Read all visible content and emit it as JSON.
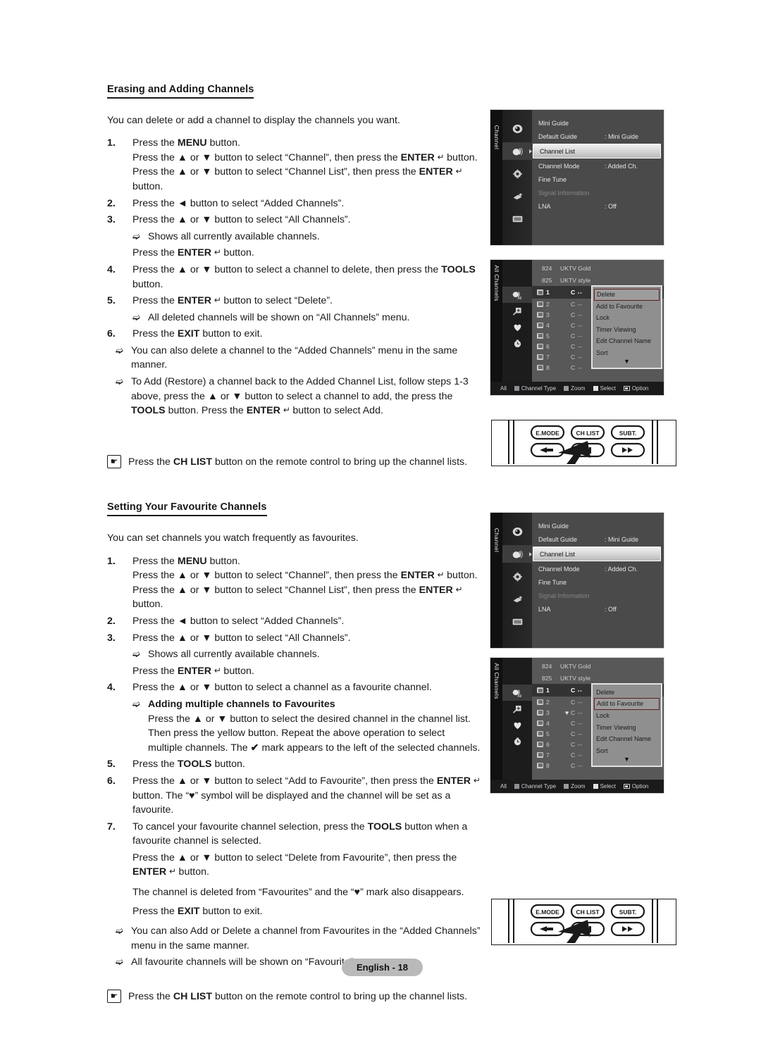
{
  "doc": {
    "footer_label": "English - 18"
  },
  "section1": {
    "heading": "Erasing and Adding Channels",
    "intro": "You can delete or add a channel to display the channels you want.",
    "steps": [
      {
        "num": "1.",
        "lines": [
          "Press the MENU button.",
          "Press the ▲ or ▼ button to select “Channel”, then press the ENTER ↵ button. Press the ▲ or ▼ button to select “Channel List”, then press the ENTER ↵ button."
        ]
      },
      {
        "num": "2.",
        "lines": [
          "Press the ◄ button to select “Added Channels”."
        ]
      },
      {
        "num": "3.",
        "lines": [
          "Press the ▲ or ▼ button to select “All Channels”."
        ]
      },
      {
        "num": "4.",
        "lines": [
          "Press the ▲ or ▼ button to select a channel to delete, then press the TOOLS button."
        ]
      },
      {
        "num": "5.",
        "lines": [
          "Press the ENTER ↵ button to select “Delete”."
        ]
      },
      {
        "num": "6.",
        "lines": [
          "Press the EXIT button to exit."
        ]
      }
    ],
    "sub_after_3a": "Shows all currently available channels.",
    "plain_after_3a": "Press the ENTER ↵ button.",
    "sub_after_5": "All deleted channels will be shown on “All Channels” menu.",
    "notes": [
      "You can also delete a channel to the “Added Channels” menu in the same manner.",
      "To Add (Restore) a channel back to the Added Channel List, follow steps 1-3 above, press the ▲ or ▼ button to select a channel to add, the press the TOOLS button. Press the ENTER ↵ button to select Add."
    ],
    "tip": "Press the CH LIST button on the remote control to bring up the channel lists."
  },
  "section2": {
    "heading": "Setting Your Favourite Channels",
    "intro": "You can set channels you watch frequently as favourites.",
    "steps": [
      {
        "num": "1.",
        "lines": [
          "Press the MENU button.",
          "Press the ▲ or ▼ button to select “Channel”, then press the ENTER ↵ button. Press the ▲ or ▼ button to select “Channel List”, then press the ENTER ↵ button."
        ]
      },
      {
        "num": "2.",
        "lines": [
          "Press the ◄ button to select “Added Channels”."
        ]
      },
      {
        "num": "3.",
        "lines": [
          "Press the ▲ or ▼ button to select “All Channels”."
        ]
      },
      {
        "num": "4.",
        "lines": [
          "Press the ▲ or ▼ button to select a channel as a favourite channel."
        ]
      },
      {
        "num": "5.",
        "lines": [
          "Press the TOOLS button."
        ]
      },
      {
        "num": "6.",
        "lines": [
          "Press the ▲ or ▼ button to select “Add to Favourite”, then press the ENTER ↵ button. The “♥” symbol will be displayed and the channel will be set as a favourite."
        ]
      },
      {
        "num": "7.",
        "lines": [
          "To cancel your favourite channel selection, press the TOOLS button when a favourite channel is selected."
        ]
      }
    ],
    "sub_after_3a": "Shows all currently available channels.",
    "plain_after_3a": "Press the ENTER ↵ button.",
    "sub_multi_title": "Adding multiple channels to Favourites",
    "sub_multi_body": "Press the ▲ or ▼ button to select the desired channel in the channel list. Then press the yellow button. Repeat the above operation to select multiple channels. The ✔ mark appears to the left of the selected channels.",
    "plain_after_7a": "Press the ▲ or ▼ button to select “Delete from Favourite”, then press the ENTER ↵ button.",
    "plain_after_7b": "The channel is deleted from “Favourites” and the “♥” mark also disappears.",
    "plain_after_7c": "Press the EXIT button to exit.",
    "notes": [
      "You can also Add or Delete a channel from Favourites in the “Added Channels” menu in the same manner.",
      "All favourite channels will be shown on “Favourite” menu."
    ],
    "tip": "Press the CH LIST button on the remote control to bring up the channel lists."
  },
  "osd_channel_menu": {
    "tab_label": "Channel",
    "icons": [
      "guide-icon",
      "channel-icon",
      "setup-icon",
      "input-icon",
      "picture-icon"
    ],
    "selected_icon_index": 1,
    "rows": [
      {
        "label": "Mini Guide",
        "value": "",
        "state": "normal"
      },
      {
        "label": "Default Guide",
        "value": ": Mini Guide",
        "state": "normal"
      },
      {
        "label": "Channel List",
        "value": "",
        "state": "highlight"
      },
      {
        "label": "Channel Mode",
        "value": ": Added Ch.",
        "state": "normal"
      },
      {
        "label": "Fine Tune",
        "value": "",
        "state": "normal"
      },
      {
        "label": "Signal Information",
        "value": "",
        "state": "disabled"
      },
      {
        "label": "LNA",
        "value": ": Off",
        "state": "normal"
      }
    ]
  },
  "osd_channel_list_1": {
    "tab_label": "All Channels",
    "icons": [
      "all-channels-icon",
      "added-channels-icon",
      "favourite-icon",
      "timer-icon"
    ],
    "selected_icon_index": 0,
    "header_rows": [
      {
        "num": "824",
        "name": "UKTV Gold"
      },
      {
        "num": "825",
        "name": "UKTV style"
      }
    ],
    "rows": [
      {
        "num": "1",
        "fav": "",
        "ch": "C --",
        "current": true
      },
      {
        "num": "2",
        "fav": "",
        "ch": "C --",
        "current": false
      },
      {
        "num": "3",
        "fav": "",
        "ch": "C --",
        "current": false
      },
      {
        "num": "4",
        "fav": "",
        "ch": "C --",
        "current": false
      },
      {
        "num": "5",
        "fav": "",
        "ch": "C --",
        "current": false
      },
      {
        "num": "6",
        "fav": "",
        "ch": "C --",
        "current": false
      },
      {
        "num": "7",
        "fav": "",
        "ch": "C --",
        "current": false
      },
      {
        "num": "8",
        "fav": "",
        "ch": "C --",
        "current": false
      }
    ],
    "popup_items": [
      "Delete",
      "Add to Favourite",
      "Lock",
      "Timer Viewing",
      "Edit Channel Name",
      "Sort"
    ],
    "popup_selected": "Delete",
    "popup_more_arrow": "▼",
    "footer": {
      "mode": "All",
      "keys": [
        {
          "label": "Channel Type",
          "color": "#8e8e96"
        },
        {
          "label": "Zoom",
          "color": "#9b9b9b"
        },
        {
          "label": "Select",
          "color": "#e3e3e3"
        },
        {
          "label": "Option",
          "color": ""
        }
      ]
    }
  },
  "osd_channel_list_2": {
    "tab_label": "All Channels",
    "icons": [
      "all-channels-icon",
      "added-channels-icon",
      "favourite-icon",
      "timer-icon"
    ],
    "selected_icon_index": 0,
    "header_rows": [
      {
        "num": "824",
        "name": "UKTV Gold"
      },
      {
        "num": "825",
        "name": "UKTV style"
      }
    ],
    "rows": [
      {
        "num": "1",
        "fav": "",
        "ch": "C --",
        "current": true
      },
      {
        "num": "2",
        "fav": "",
        "ch": "C --",
        "current": false
      },
      {
        "num": "3",
        "fav": "♥",
        "ch": "C --",
        "current": false
      },
      {
        "num": "4",
        "fav": "",
        "ch": "C --",
        "current": false
      },
      {
        "num": "5",
        "fav": "",
        "ch": "C --",
        "current": false
      },
      {
        "num": "6",
        "fav": "",
        "ch": "C --",
        "current": false
      },
      {
        "num": "7",
        "fav": "",
        "ch": "C --",
        "current": false
      },
      {
        "num": "8",
        "fav": "",
        "ch": "C --",
        "current": false
      }
    ],
    "popup_items": [
      "Delete",
      "Add to Favourite",
      "Lock",
      "Timer Viewing",
      "Edit Channel Name",
      "Sort"
    ],
    "popup_selected": "Add to Favourite",
    "popup_more_arrow": "▼",
    "footer": {
      "mode": "All",
      "keys": [
        {
          "label": "Channel Type",
          "color": "#8e8e96"
        },
        {
          "label": "Zoom",
          "color": "#9b9b9b"
        },
        {
          "label": "Select",
          "color": "#e3e3e3"
        },
        {
          "label": "Option",
          "color": ""
        }
      ]
    }
  },
  "remote": {
    "buttons_top": [
      "E.MODE",
      "CH LIST",
      "SUBT."
    ],
    "buttons_bottom": [
      "rewind-icon",
      "pause-icon",
      "fast-forward-icon"
    ]
  }
}
